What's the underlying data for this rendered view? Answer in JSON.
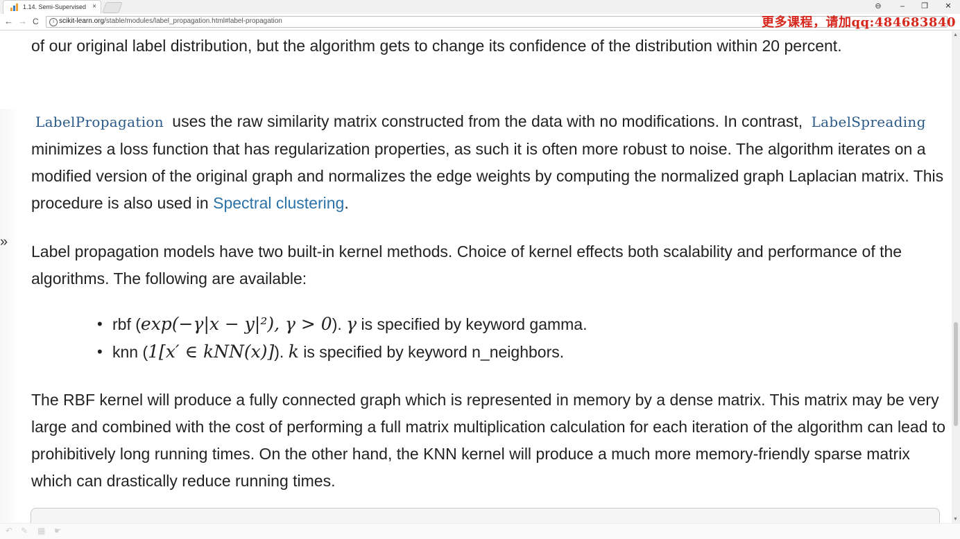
{
  "browser": {
    "tab_title": "1.14. Semi-Supervised",
    "tab_close": "×",
    "window_controls": {
      "account": "⊖",
      "minimize": "–",
      "maximize": "❐",
      "close": "✕"
    },
    "nav": {
      "back": "←",
      "forward": "→",
      "reload": "C"
    },
    "url_host": "scikit-learn.org",
    "url_path": "/stable/modules/label_propagation.html#label-propagation",
    "info_glyph": "i"
  },
  "watermark": "更多课程，请加qq:484683840",
  "sidebar_toggle": "»",
  "content": {
    "p1": "of our original label distribution, but the algorithm gets to change its confidence of the distribution within 20 percent.",
    "p2": {
      "code1": "LabelPropagation",
      "text1": " uses the raw similarity matrix constructed from the data with no modifications. In contrast, ",
      "code2": "LabelSpreading",
      "text2": " minimizes a loss function that has regularization properties, as such it is often more robust to noise. The algorithm iterates on a modified version of the original graph and normalizes the edge weights by computing the normalized graph Laplacian matrix. This procedure is also used in ",
      "link": "Spectral clustering",
      "text3": "."
    },
    "p3": "Label propagation models have two built-in kernel methods. Choice of kernel effects both scalability and performance of the algorithms. The following are available:",
    "kernels": [
      {
        "name": "rbf",
        "open": " (",
        "math": "exp(−γ|x − y|²), γ > 0",
        "close": "). ",
        "param_symbol": "γ",
        "desc": " is specified by keyword gamma."
      },
      {
        "name": "knn",
        "open": " (",
        "math": "1[x′ ∈ kNN(x)]",
        "close": "). ",
        "param_symbol": "k",
        "desc": " is specified by keyword n_neighbors."
      }
    ],
    "p4": "The RBF kernel will produce a fully connected graph which is represented in memory by a dense matrix. This matrix may be very large and combined with the cost of performing a full matrix multiplication calculation for each iteration of the algorithm can lead to prohibitively long running times. On the other hand, the KNN kernel will produce a much more memory-friendly sparse matrix which can drastically reduce running times."
  },
  "scrollbar": {
    "up": "▲",
    "down": "▼"
  },
  "colors": {
    "link": "#2a72a8",
    "code": "#2a5a8a",
    "watermark": "#d7261b",
    "text": "#222222"
  }
}
